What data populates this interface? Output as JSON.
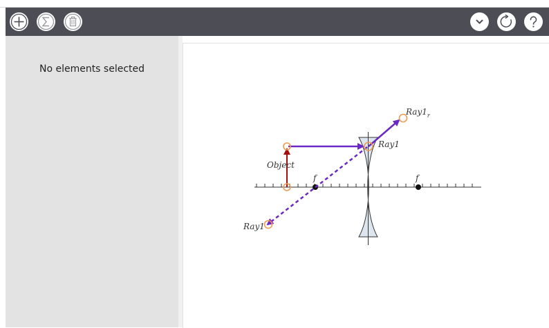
{
  "toolbar": {
    "buttons_left": [
      {
        "name": "add",
        "icon": "plus-icon"
      },
      {
        "name": "functions",
        "icon": "sigma-icon"
      },
      {
        "name": "delete",
        "icon": "trash-icon"
      }
    ],
    "buttons_right": [
      {
        "name": "dropdown",
        "icon": "chevron-down-icon"
      },
      {
        "name": "reset",
        "icon": "refresh-icon"
      },
      {
        "name": "help",
        "icon": "question-icon"
      }
    ]
  },
  "sidebar": {
    "status_text": "No elements selected"
  },
  "diagram": {
    "object_label": "Object",
    "focal_label_left": "f",
    "focal_label_right": "f",
    "ray_label_top": "Ray1",
    "ray_label_top_subscript": "r",
    "ray_label_lens": "Ray1",
    "ray_label_bottom": "Ray1",
    "colors": {
      "object_arrow": "#a30f0f",
      "ray": "#6a28c4",
      "handle": "#ef9a52",
      "axis": "#333333",
      "lens_fill": "#dde6ee"
    }
  }
}
